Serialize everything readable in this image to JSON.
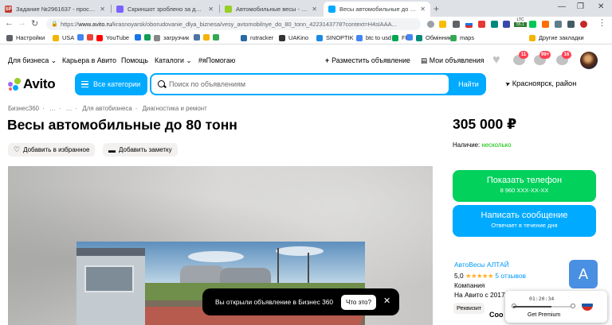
{
  "browser": {
    "tabs": [
      {
        "favicon": "SP",
        "favicon_color": "#c0392b",
        "title": "Задание №2961637 - просмотр з"
      },
      {
        "favicon": "",
        "favicon_color": "#7b61ff",
        "title": "Скриншот зроблено за допомого"
      },
      {
        "favicon": "",
        "favicon_color": "#97cf26",
        "title": "Автомобильные весы - Купить о"
      },
      {
        "favicon": "",
        "favicon_color": "#00aaff",
        "title": "Весы автомобильные до 80 тонн"
      }
    ],
    "new_tab": "+",
    "controls": {
      "minimize": "—",
      "maximize": "❐",
      "close": "✕"
    },
    "url_prefix": "https://",
    "url_host": "www.avito.ru",
    "url_path": "/krasnoyarsk/oborudovanie_dlya_biznesa/vesy_avtomobilnye_do_80_tonn_4223143778?context=H4sIAAA...",
    "ltc": {
      "label": "LTC",
      "value": "55.1"
    },
    "bookmarks": [
      {
        "label": "Настройки",
        "color": "#5f6368"
      },
      {
        "label": "USA",
        "color": "#f4b400"
      },
      {
        "label": "",
        "color": "#4285f4"
      },
      {
        "label": "",
        "color": "#ea4335"
      },
      {
        "label": "YouTube",
        "color": "#ff0000"
      },
      {
        "label": "",
        "color": "#1a73e8"
      },
      {
        "label": "",
        "color": "#0f9d58"
      },
      {
        "label": "загрузчик",
        "color": "#888888"
      },
      {
        "label": "",
        "color": "#4c75a3"
      },
      {
        "label": "",
        "color": "#f4b400"
      },
      {
        "label": "",
        "color": "#34a853"
      },
      {
        "label": "rutracker",
        "color": "#2b6aa3"
      },
      {
        "label": "UAKino",
        "color": "#333333"
      },
      {
        "label": "SINOPTIK",
        "color": "#1e88e5"
      },
      {
        "label": "btc to usd",
        "color": "#4285f4"
      },
      {
        "label": "FP",
        "color": "#00a650"
      },
      {
        "label": "",
        "color": "#4285f4"
      },
      {
        "label": "Обмінник",
        "color": "#00897b"
      },
      {
        "label": "maps",
        "color": "#34a853"
      },
      {
        "label": "Другие закладки",
        "color": "#f4b400"
      }
    ]
  },
  "topnav": {
    "business": "Для бизнеса",
    "career": "Карьера в Авито",
    "help": "Помощь",
    "catalogs": "Каталоги",
    "hashtag": "#яПомогаю",
    "post_ad": "Разместить объявление",
    "my_ads": "Мои объявления",
    "badges": {
      "messages": "11",
      "notifications": "99+",
      "cart": "16"
    }
  },
  "search": {
    "logo": "Avito",
    "categories_button": "Все категории",
    "placeholder": "Поиск по объявлениям",
    "find_button": "Найти",
    "region": "Красноярск, район"
  },
  "listing": {
    "breadcrumbs": [
      "Бизнес360",
      "…",
      "…",
      "Для автобизнеса",
      "Диагностика и ремонт"
    ],
    "title": "Весы автомобильные до 80 тонн",
    "add_favorite": "Добавить в избранное",
    "add_note": "Добавить заметку",
    "price": "305 000 ₽",
    "availability_label": "Наличие:",
    "availability_value": "несколько",
    "phone_button": "Показать телефон",
    "phone_masked": "8 960 XXX-XX-XX",
    "message_button": "Написать сообщение",
    "message_sub": "Отвечает в течение дня",
    "seller": {
      "name": "АвтоВесы АЛТАЙ",
      "rating": "5,0",
      "stars": "★★★★★",
      "reviews": "5 отзывов",
      "type": "Компания",
      "since": "На Авито с 2017 г.",
      "avatar_letter": "A",
      "badge": "Реквизит"
    }
  },
  "toast": {
    "message": "Вы открыли объявление в Бизнес 360",
    "what_button": "Что это?",
    "close": "✕"
  },
  "vpn": {
    "timer": "01:20:34",
    "premium": "Get Premium"
  },
  "peek_text": "Соо"
}
